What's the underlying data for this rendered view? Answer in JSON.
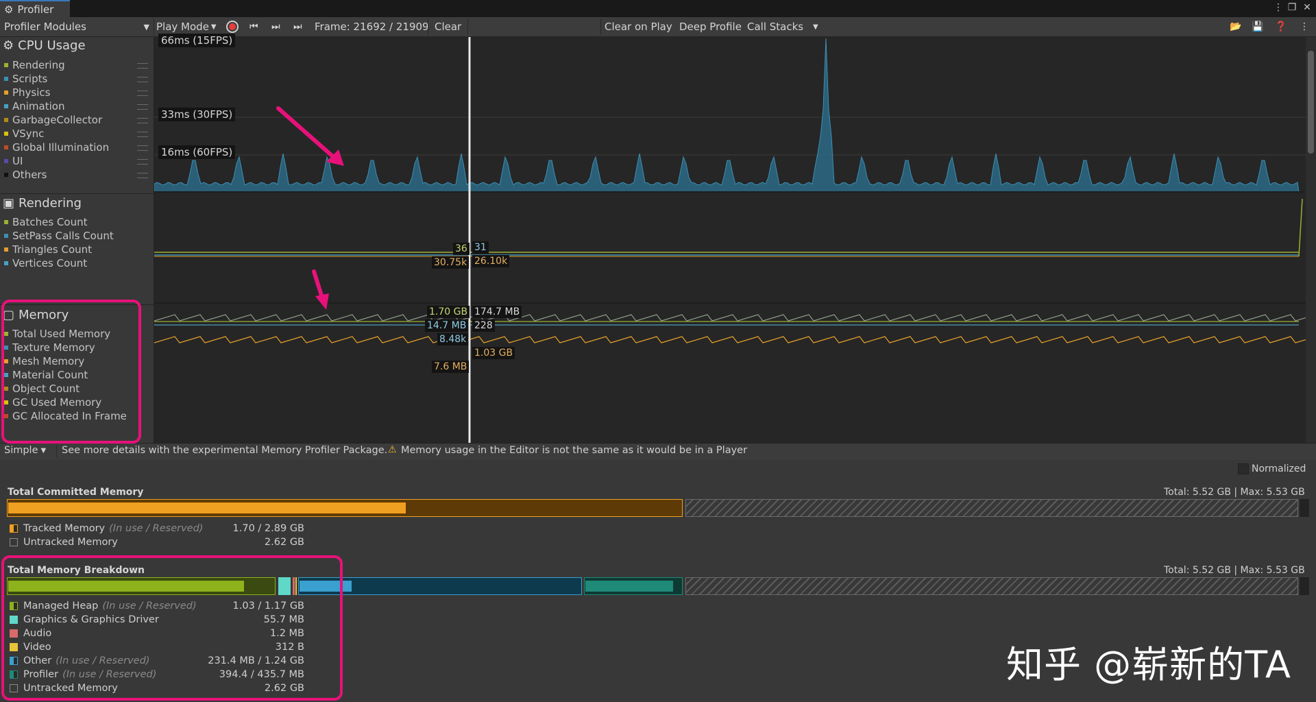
{
  "window": {
    "tab_title": "Profiler"
  },
  "toolbar": {
    "modules": "Profiler Modules",
    "play_mode": "Play Mode",
    "frame": "Frame: 21692 / 21909",
    "clear": "Clear",
    "clear_on_play": "Clear on Play",
    "deep_profile": "Deep Profile",
    "call_stacks": "Call Stacks"
  },
  "cpu": {
    "title": "CPU Usage",
    "items": [
      {
        "label": "Rendering",
        "color": "#9eb031"
      },
      {
        "label": "Scripts",
        "color": "#3d8fb3"
      },
      {
        "label": "Physics",
        "color": "#e3a02a"
      },
      {
        "label": "Animation",
        "color": "#4aa0c4"
      },
      {
        "label": "GarbageCollector",
        "color": "#b28a1a"
      },
      {
        "label": "VSync",
        "color": "#d8c010"
      },
      {
        "label": "Global Illumination",
        "color": "#c04a28"
      },
      {
        "label": "UI",
        "color": "#5b4aa8"
      },
      {
        "label": "Others",
        "color": "#111111"
      }
    ],
    "fps_labels": [
      "66ms (15FPS)",
      "33ms (30FPS)",
      "16ms (60FPS)"
    ]
  },
  "rendering": {
    "title": "Rendering",
    "items": [
      {
        "label": "Batches Count",
        "color": "#9eb031"
      },
      {
        "label": "SetPass Calls Count",
        "color": "#3d8fb3"
      },
      {
        "label": "Triangles Count",
        "color": "#e3a02a"
      },
      {
        "label": "Vertices Count",
        "color": "#4aa0c4"
      }
    ],
    "values_left": [
      "36",
      "30.75k"
    ],
    "values_right": [
      "31",
      "26.10k"
    ]
  },
  "memory": {
    "title": "Memory",
    "items": [
      {
        "label": "Total Used Memory",
        "color": "#9eb031"
      },
      {
        "label": "Texture Memory",
        "color": "#3d8fb3"
      },
      {
        "label": "Mesh Memory",
        "color": "#e3a02a"
      },
      {
        "label": "Material Count",
        "color": "#4aa0c4"
      },
      {
        "label": "Object Count",
        "color": "#b28a1a"
      },
      {
        "label": "GC Used Memory",
        "color": "#d8c010"
      },
      {
        "label": "GC Allocated In Frame",
        "color": "#c04a28"
      }
    ],
    "values_left": [
      "1.70 GB",
      "14.7 MB",
      "8.48k",
      "7.6 MB"
    ],
    "values_right": [
      "174.7 MB",
      "228",
      "1.03 GB"
    ]
  },
  "status": {
    "view_mode": "Simple",
    "message": "See more details with the experimental Memory Profiler Package.",
    "warning": "Memory usage in the Editor is not the same as it would be in a Player"
  },
  "detail": {
    "normalized": "Normalized",
    "committed": {
      "title": "Total Committed Memory",
      "total": "Total: 5.52 GB | Max: 5.53 GB",
      "rows": [
        {
          "label": "Tracked Memory",
          "sub": "(In use / Reserved)",
          "value": "1.70 / 2.89 GB",
          "color": "#f0a020"
        },
        {
          "label": "Untracked Memory",
          "sub": "",
          "value": "2.62 GB",
          "color": "hatch"
        }
      ]
    },
    "breakdown": {
      "title": "Total Memory Breakdown",
      "total": "Total: 5.52 GB | Max: 5.53 GB",
      "rows": [
        {
          "label": "Managed Heap",
          "sub": "(In use / Reserved)",
          "value": "1.03 / 1.17 GB",
          "color": "#8db21c"
        },
        {
          "label": "Graphics & Graphics Driver",
          "sub": "",
          "value": "55.7 MB",
          "color": "#5fd8c8"
        },
        {
          "label": "Audio",
          "sub": "",
          "value": "1.2 MB",
          "color": "#d86a6a"
        },
        {
          "label": "Video",
          "sub": "",
          "value": "312 B",
          "color": "#e8c23a"
        },
        {
          "label": "Other",
          "sub": "(In use / Reserved)",
          "value": "231.4 MB / 1.24 GB",
          "color": "#3aa0d0"
        },
        {
          "label": "Profiler",
          "sub": "(In use / Reserved)",
          "value": "394.4 / 435.7 MB",
          "color": "#1f8a78"
        },
        {
          "label": "Untracked Memory",
          "sub": "",
          "value": "2.62 GB",
          "color": "hatch"
        }
      ]
    }
  },
  "watermark": "知乎 @崭新的TA"
}
